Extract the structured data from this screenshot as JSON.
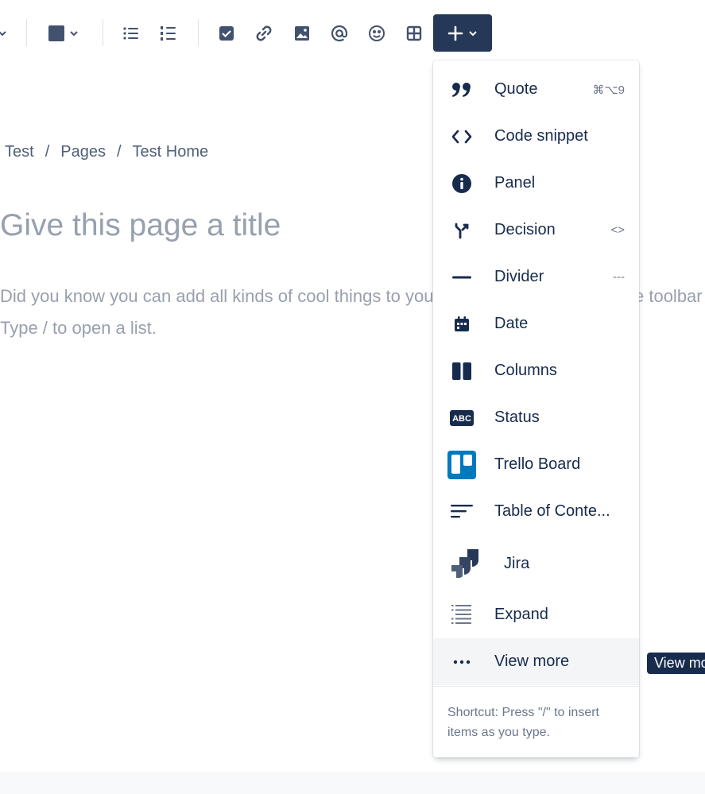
{
  "breadcrumb": {
    "items": [
      "Test",
      "Pages",
      "Test Home"
    ],
    "separator": "/"
  },
  "editor": {
    "title_placeholder": "Give this page a title",
    "body_placeholder_line1": "Did you know you can add all kinds of cool things to your page? Select the + on the toolbar to add content",
    "body_placeholder_line2": "Type / to open a list."
  },
  "toolbar": {
    "icons": [
      "chevron-down-icon",
      "text-color-icon",
      "bullet-list-icon",
      "numbered-list-icon",
      "task-checkbox-icon",
      "link-icon",
      "image-icon",
      "mention-icon",
      "emoji-icon",
      "table-icon",
      "plus-icon"
    ],
    "insert_button_color": "#253858"
  },
  "insert_menu": {
    "items": [
      {
        "label": "Quote",
        "shortcut": "⌘⌥9",
        "icon": "quote-icon"
      },
      {
        "label": "Code snippet",
        "shortcut": "",
        "icon": "code-icon"
      },
      {
        "label": "Panel",
        "shortcut": "",
        "icon": "info-icon"
      },
      {
        "label": "Decision",
        "shortcut": "<>",
        "icon": "decision-icon"
      },
      {
        "label": "Divider",
        "shortcut": "---",
        "icon": "divider-icon"
      },
      {
        "label": "Date",
        "shortcut": "",
        "icon": "calendar-icon"
      },
      {
        "label": "Columns",
        "shortcut": "",
        "icon": "columns-icon"
      },
      {
        "label": "Status",
        "shortcut": "",
        "icon": "status-icon"
      },
      {
        "label": "Trello Board",
        "shortcut": "",
        "icon": "trello-icon"
      },
      {
        "label": "Table of Conte...",
        "shortcut": "",
        "icon": "table-of-contents-icon"
      },
      {
        "label": "Jira",
        "shortcut": "",
        "icon": "jira-icon"
      },
      {
        "label": "Expand",
        "shortcut": "",
        "icon": "expand-icon"
      },
      {
        "label": "View more",
        "shortcut": "",
        "icon": "more-icon"
      }
    ],
    "status_icon_text": "ABC",
    "footer": "Shortcut: Press \"/\" to insert items as you type."
  },
  "tooltip": "View more",
  "colors": {
    "text": "#172b4d",
    "placeholder": "#97a0af",
    "trello": "#0079bf",
    "hover": "#f4f5f7"
  }
}
